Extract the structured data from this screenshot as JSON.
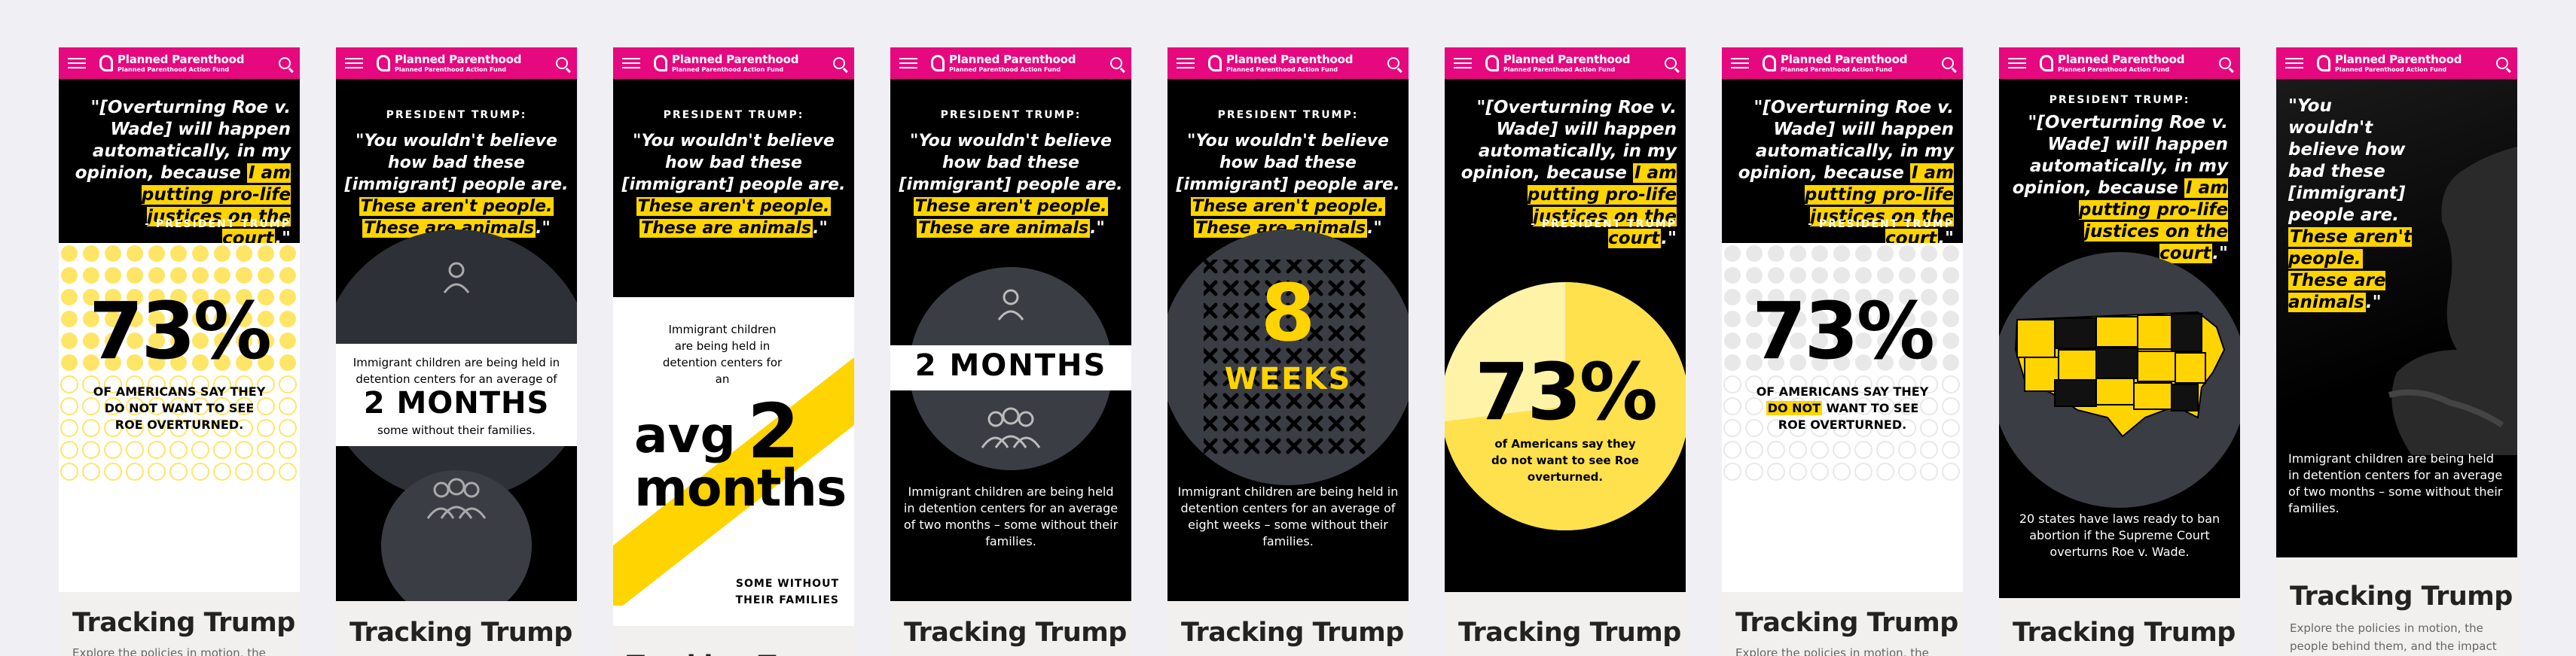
{
  "brand": {
    "name": "Planned Parenthood",
    "sub": "Planned Parenthood Action Fund",
    "colors": {
      "pink": "#e5087f",
      "yellow": "#ffd400",
      "black": "#000000"
    }
  },
  "icons": {
    "menu": "hamburger-icon",
    "search": "search-icon",
    "person": "person-icon",
    "group": "group-icon"
  },
  "footer": {
    "title": "Tracking Trump",
    "desc": "Explore the policies in motion, the people behind them, and the impact"
  },
  "cards": [
    {
      "quote_pre": "\"[Overturning Roe v. Wade] will happen automatically, in my opinion, because",
      "quote_hl": "I am putting pro-life justices on the court",
      "quote_end": ".\"",
      "attribution": "- PRESIDENT TRUMP",
      "stat": "73%",
      "caption": "OF AMERICANS SAY THEY DO NOT WANT TO SEE ROE OVERTURNED."
    },
    {
      "lead": "PRESIDENT TRUMP:",
      "quote": "\"You wouldn't believe how bad these [immigrant] people are.",
      "hl1": "These aren't people.",
      "hl2": "These are animals",
      "end": ".\"",
      "text": "Immigrant children are being held in detention centers for an average of",
      "big": "2 MONTHS",
      "sub": "some without their families."
    },
    {
      "lead": "PRESIDENT TRUMP:",
      "quote": "\"You wouldn't believe how bad these [immigrant] people are.",
      "hl1": "These aren't people.",
      "hl2": "These are animals",
      "end": ".\"",
      "text": "Immigrant children are being held in detention centers for an",
      "w1": "avg",
      "w2": "2",
      "w3": "months",
      "sub": "SOME WITHOUT THEIR FAMILIES"
    },
    {
      "lead": "PRESIDENT TRUMP:",
      "quote": "\"You wouldn't believe how bad these [immigrant] people are.",
      "hl1": "These aren't people.",
      "hl2": "These are animals",
      "end": ".\"",
      "big": "2 MONTHS",
      "text": "Immigrant children are being held in detention centers for an average of two months – some without their families."
    },
    {
      "lead": "PRESIDENT TRUMP:",
      "quote": "\"You wouldn't believe how bad these [immigrant] people are.",
      "hl1": "These aren't people.",
      "hl2": "These are animals",
      "end": ".\"",
      "num": "8",
      "unit": "WEEKS",
      "text": "Immigrant children are being held in detention centers for an average of eight weeks – some without their families."
    },
    {
      "quote_pre": "\"[Overturning Roe v. Wade] will happen automatically, in my opinion, because",
      "quote_hl": "I am putting pro-life justices on the court",
      "quote_end": ".\"",
      "attribution": "- PRESIDENT TRUMP",
      "stat": "73%",
      "caption": "of Americans say they do not want to see Roe overturned.",
      "pct": 0.73
    },
    {
      "quote_pre": "\"[Overturning Roe v. Wade] will happen automatically, in my opinion, because",
      "quote_hl": "I am putting pro-life justices on the court",
      "quote_end": ".\"",
      "attribution": "- PRESIDENT TRUMP",
      "stat": "73%",
      "cap1": "OF AMERICANS SAY THEY",
      "cap_hl": "DO NOT",
      "cap2": "WANT TO SEE ROE OVERTURNED."
    },
    {
      "lead": "PRESIDENT TRUMP:",
      "quote_pre": "\"[Overturning Roe v. Wade] will happen automatically, in my opinion, because",
      "quote_hl": "I am putting pro-life justices on the court",
      "quote_end": ".\"",
      "text": "20 states have laws ready to ban abortion if the Supreme Court overturns Roe v. Wade."
    },
    {
      "quote": "\"You wouldn't believe how bad these [immigrant] people are.",
      "hl1": "These aren't people.",
      "hl2": "These are animals",
      "end": ".\"",
      "text": "Immigrant children are being held in detention centers for an average of two months – some without their families."
    }
  ]
}
